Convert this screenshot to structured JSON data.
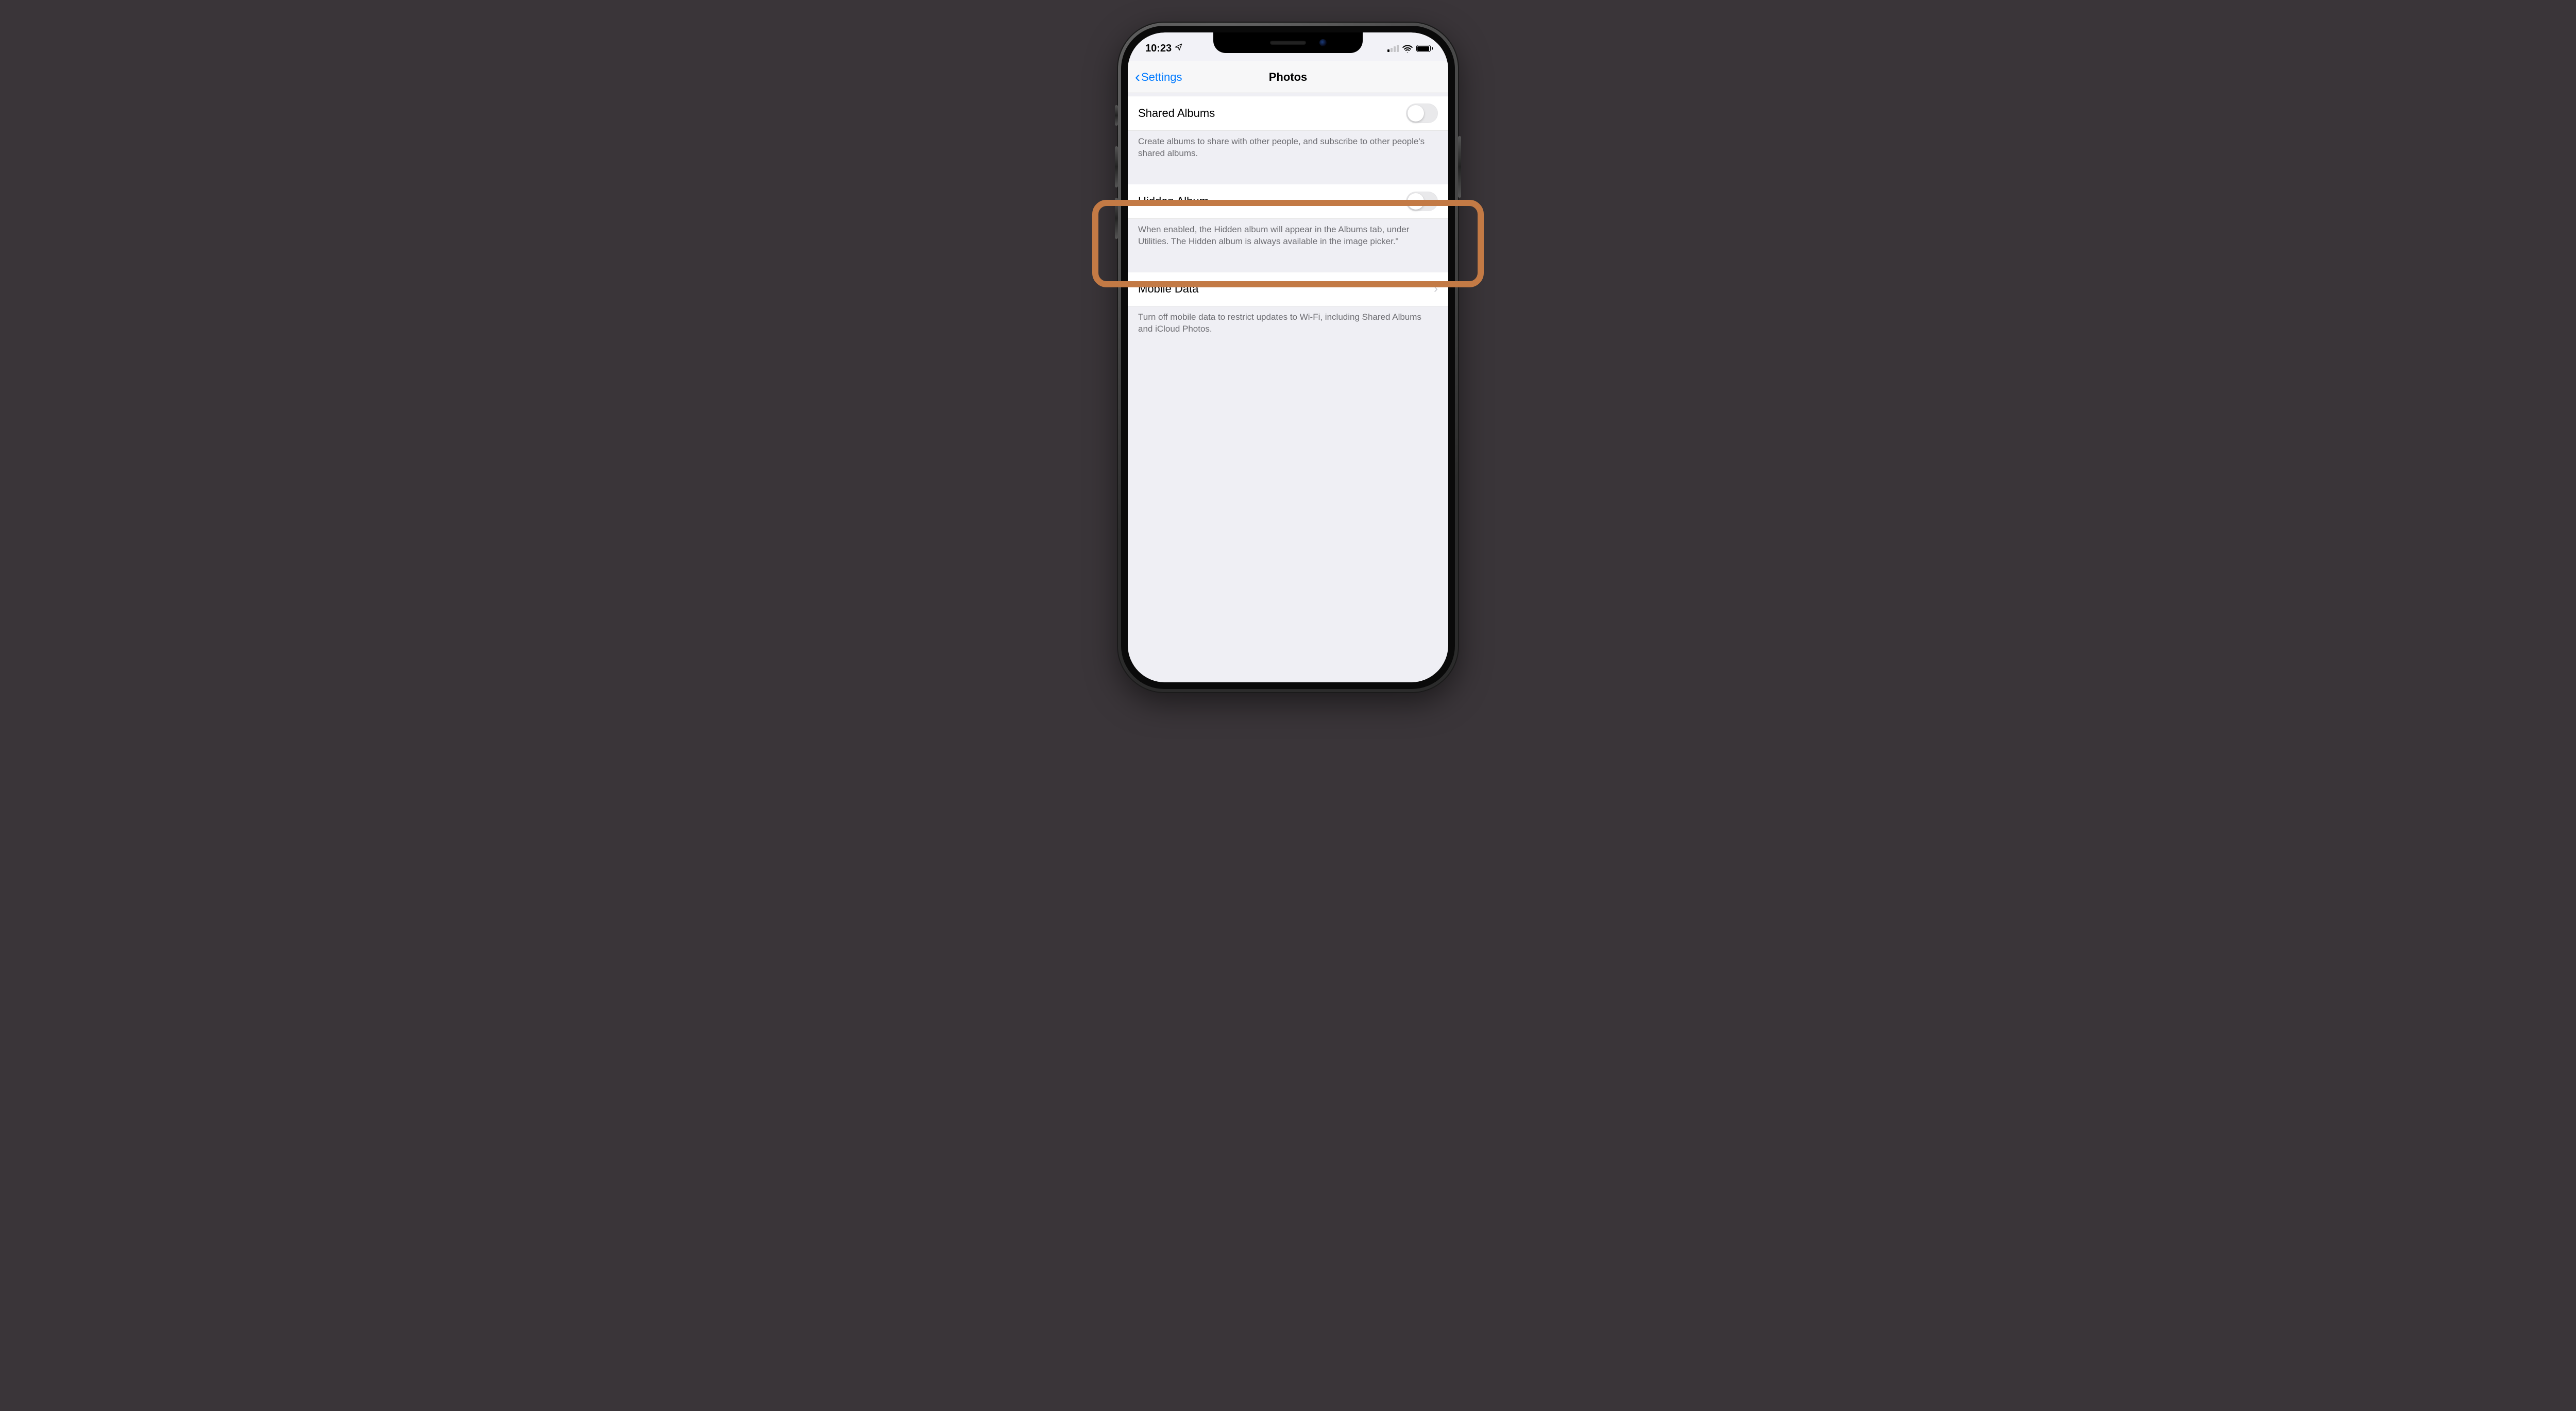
{
  "statusbar": {
    "time": "10:23",
    "location_icon": "location-arrow-icon",
    "signal_bars_active": 1,
    "signal_bars_total": 4,
    "wifi_icon": "wifi-icon",
    "battery_icon": "battery-full-icon"
  },
  "nav": {
    "back_label": "Settings",
    "title": "Photos"
  },
  "sections": {
    "shared": {
      "label": "Shared Albums",
      "toggle_on": false,
      "footer": "Create albums to share with other people, and subscribe to other people's shared albums."
    },
    "hidden": {
      "label": "Hidden Album",
      "toggle_on": false,
      "footer": "When enabled, the Hidden album will appear in the Albums tab, under Utilities. The Hidden album is always available in the image picker.\""
    },
    "mobile": {
      "label": "Mobile Data",
      "footer": "Turn off mobile data to restrict updates to Wi-Fi, including Shared Albums and iCloud Photos."
    }
  },
  "highlight": {
    "accent_color": "#c37a45"
  }
}
